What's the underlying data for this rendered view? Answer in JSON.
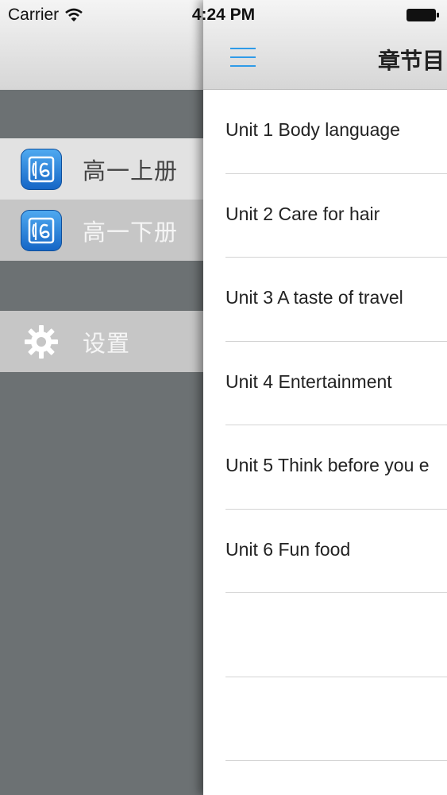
{
  "status_bar": {
    "carrier": "Carrier",
    "time": "4:24 PM",
    "icons": [
      "wifi-icon",
      "battery-icon"
    ]
  },
  "menu": {
    "books": [
      {
        "label": "高一上册",
        "icon": "book-app-icon",
        "selected": true
      },
      {
        "label": "高一下册",
        "icon": "book-app-icon",
        "selected": false
      }
    ],
    "settings": {
      "label": "设置",
      "icon": "gear-icon"
    }
  },
  "nav_bar": {
    "title": "章节目",
    "menu_icon": "hamburger-icon",
    "accent_color": "#2f9be8"
  },
  "units": [
    "Unit 1 Body language",
    "Unit 2 Care for hair",
    "Unit 3 A taste of travel",
    "Unit 4 Entertainment",
    "Unit 5 Think before you e",
    "Unit 6 Fun food",
    "",
    ""
  ]
}
